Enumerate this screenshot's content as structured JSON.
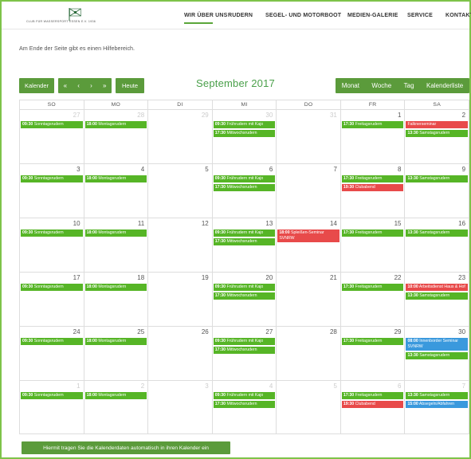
{
  "logo": {
    "text": "CLUB FÜR WASSERSPORT ESSEN E.V. 1936"
  },
  "nav": [
    {
      "label": "WIR ÜBER UNS",
      "name": "nav-wir-ueber-uns"
    },
    {
      "label": "RUDERN",
      "name": "nav-rudern"
    },
    {
      "label": "SEGEL- UND MOTORBOOT",
      "name": "nav-segel-motorboot"
    },
    {
      "label": "MEDIEN-GALERIE",
      "name": "nav-medien-galerie"
    },
    {
      "label": "SERVICE",
      "name": "nav-service"
    },
    {
      "label": "KONTAKT",
      "name": "nav-kontakt"
    }
  ],
  "info_text": "Am Ende der Seite gibt es einen Hilfebereich.",
  "toolbar": {
    "calendar_label": "Kalender",
    "nav_arrows": [
      "«",
      "‹",
      "›",
      "»"
    ],
    "today_label": "Heute",
    "month_title": "September 2017",
    "views": [
      "Monat",
      "Woche",
      "Tag",
      "Kalenderliste"
    ]
  },
  "weekdays": [
    "SO",
    "MO",
    "DI",
    "MI",
    "DO",
    "FR",
    "SA"
  ],
  "weeks": [
    [
      {
        "day": "27",
        "other": true,
        "events": [
          {
            "time": "09:30",
            "title": "Sonntagsrudern",
            "color": "green"
          }
        ]
      },
      {
        "day": "28",
        "other": true,
        "events": [
          {
            "time": "18:00",
            "title": "Montagsrudern",
            "color": "green"
          }
        ]
      },
      {
        "day": "29",
        "other": true,
        "events": []
      },
      {
        "day": "30",
        "other": true,
        "events": [
          {
            "time": "09:30",
            "title": "Frührudern mit Kajo",
            "color": "green"
          },
          {
            "time": "17:30",
            "title": "Mittwochsrudern",
            "color": "green"
          }
        ]
      },
      {
        "day": "31",
        "other": true,
        "events": []
      },
      {
        "day": "1",
        "other": false,
        "events": [
          {
            "time": "17:30",
            "title": "Freitagsrudern",
            "color": "green"
          }
        ]
      },
      {
        "day": "2",
        "other": false,
        "events": [
          {
            "time": "",
            "title": "Falknerseminar",
            "color": "red"
          },
          {
            "time": "13:30",
            "title": "Samstagsrudern",
            "color": "green"
          }
        ]
      }
    ],
    [
      {
        "day": "3",
        "other": false,
        "events": [
          {
            "time": "09:30",
            "title": "Sonntagsrudern",
            "color": "green"
          }
        ]
      },
      {
        "day": "4",
        "other": false,
        "events": [
          {
            "time": "18:00",
            "title": "Montagsrudern",
            "color": "green"
          }
        ]
      },
      {
        "day": "5",
        "other": false,
        "events": []
      },
      {
        "day": "6",
        "other": false,
        "events": [
          {
            "time": "09:30",
            "title": "Frührudern mit Kajo",
            "color": "green"
          },
          {
            "time": "17:30",
            "title": "Mittwochsrudern",
            "color": "green"
          }
        ]
      },
      {
        "day": "7",
        "other": false,
        "events": []
      },
      {
        "day": "8",
        "other": false,
        "events": [
          {
            "time": "17:30",
            "title": "Freitagsrudern",
            "color": "green"
          },
          {
            "time": "19:30",
            "title": "Clubabend",
            "color": "red"
          }
        ]
      },
      {
        "day": "9",
        "other": false,
        "events": [
          {
            "time": "13:30",
            "title": "Samstagsrudern",
            "color": "green"
          }
        ]
      }
    ],
    [
      {
        "day": "10",
        "other": false,
        "events": [
          {
            "time": "09:30",
            "title": "Sonntagsrudern",
            "color": "green"
          }
        ]
      },
      {
        "day": "11",
        "other": false,
        "events": [
          {
            "time": "18:00",
            "title": "Montagsrudern",
            "color": "green"
          }
        ]
      },
      {
        "day": "12",
        "other": false,
        "events": []
      },
      {
        "day": "13",
        "other": false,
        "events": [
          {
            "time": "09:30",
            "title": "Frührudern mit Kajo",
            "color": "green"
          },
          {
            "time": "17:30",
            "title": "Mittwochsrudern",
            "color": "green"
          }
        ]
      },
      {
        "day": "14",
        "other": false,
        "events": [
          {
            "time": "18:00",
            "title": "Spleißen-Seminar SVNRW",
            "color": "red"
          }
        ]
      },
      {
        "day": "15",
        "other": false,
        "events": [
          {
            "time": "17:30",
            "title": "Freitagsrudern",
            "color": "green"
          }
        ]
      },
      {
        "day": "16",
        "other": false,
        "events": [
          {
            "time": "13:30",
            "title": "Samstagsrudern",
            "color": "green"
          }
        ]
      }
    ],
    [
      {
        "day": "17",
        "other": false,
        "events": [
          {
            "time": "09:30",
            "title": "Sonntagsrudern",
            "color": "green"
          }
        ]
      },
      {
        "day": "18",
        "other": false,
        "events": [
          {
            "time": "18:00",
            "title": "Montagsrudern",
            "color": "green"
          }
        ]
      },
      {
        "day": "19",
        "other": false,
        "events": []
      },
      {
        "day": "20",
        "other": false,
        "events": [
          {
            "time": "09:30",
            "title": "Frührudern mit Kajo",
            "color": "green"
          },
          {
            "time": "17:30",
            "title": "Mittwochsrudern",
            "color": "green"
          }
        ]
      },
      {
        "day": "21",
        "other": false,
        "events": []
      },
      {
        "day": "22",
        "other": false,
        "events": [
          {
            "time": "17:30",
            "title": "Freitagsrudern",
            "color": "green"
          }
        ]
      },
      {
        "day": "23",
        "other": false,
        "events": [
          {
            "time": "10:00",
            "title": "Arbeitsdienst Haus & Hof",
            "color": "red"
          },
          {
            "time": "13:30",
            "title": "Samstagsrudern",
            "color": "green"
          }
        ]
      }
    ],
    [
      {
        "day": "24",
        "other": false,
        "events": [
          {
            "time": "09:30",
            "title": "Sonntagsrudern",
            "color": "green"
          }
        ]
      },
      {
        "day": "25",
        "other": false,
        "events": [
          {
            "time": "18:00",
            "title": "Montagsrudern",
            "color": "green"
          }
        ]
      },
      {
        "day": "26",
        "other": false,
        "events": []
      },
      {
        "day": "27",
        "other": false,
        "events": [
          {
            "time": "09:30",
            "title": "Frührudern mit Kajo",
            "color": "green"
          },
          {
            "time": "17:30",
            "title": "Mittwochsrudern",
            "color": "green"
          }
        ]
      },
      {
        "day": "28",
        "other": false,
        "events": []
      },
      {
        "day": "29",
        "other": false,
        "events": [
          {
            "time": "17:30",
            "title": "Freitagsrudern",
            "color": "green"
          }
        ]
      },
      {
        "day": "30",
        "other": false,
        "events": [
          {
            "time": "08:00",
            "title": "Innenborder Seminar SVNRW",
            "color": "blue"
          },
          {
            "time": "13:30",
            "title": "Samstagsrudern",
            "color": "green"
          }
        ]
      }
    ],
    [
      {
        "day": "1",
        "other": true,
        "events": [
          {
            "time": "09:30",
            "title": "Sonntagsrudern",
            "color": "green"
          }
        ]
      },
      {
        "day": "2",
        "other": true,
        "events": [
          {
            "time": "18:00",
            "title": "Montagsrudern",
            "color": "green"
          }
        ]
      },
      {
        "day": "3",
        "other": true,
        "events": []
      },
      {
        "day": "4",
        "other": true,
        "events": [
          {
            "time": "09:30",
            "title": "Frührudern mit Kajo",
            "color": "green"
          },
          {
            "time": "17:30",
            "title": "Mittwochsrudern",
            "color": "green"
          }
        ]
      },
      {
        "day": "5",
        "other": true,
        "events": []
      },
      {
        "day": "6",
        "other": true,
        "events": [
          {
            "time": "17:30",
            "title": "Freitagsrudern",
            "color": "green"
          },
          {
            "time": "19:30",
            "title": "Clubabend",
            "color": "red"
          }
        ]
      },
      {
        "day": "7",
        "other": true,
        "events": [
          {
            "time": "13:30",
            "title": "Samstagsrudern",
            "color": "green"
          },
          {
            "time": "15:00",
            "title": "Absegeln/Abfahren",
            "color": "blue"
          }
        ]
      }
    ]
  ],
  "ical_button": "Hiermit tragen Sie die Kalenderdaten automatisch in ihren Kalender ein",
  "colors": {
    "accent": "#5b9b3b",
    "event_green": "#56b526",
    "event_red": "#e84a4a",
    "event_blue": "#3a99dd"
  }
}
